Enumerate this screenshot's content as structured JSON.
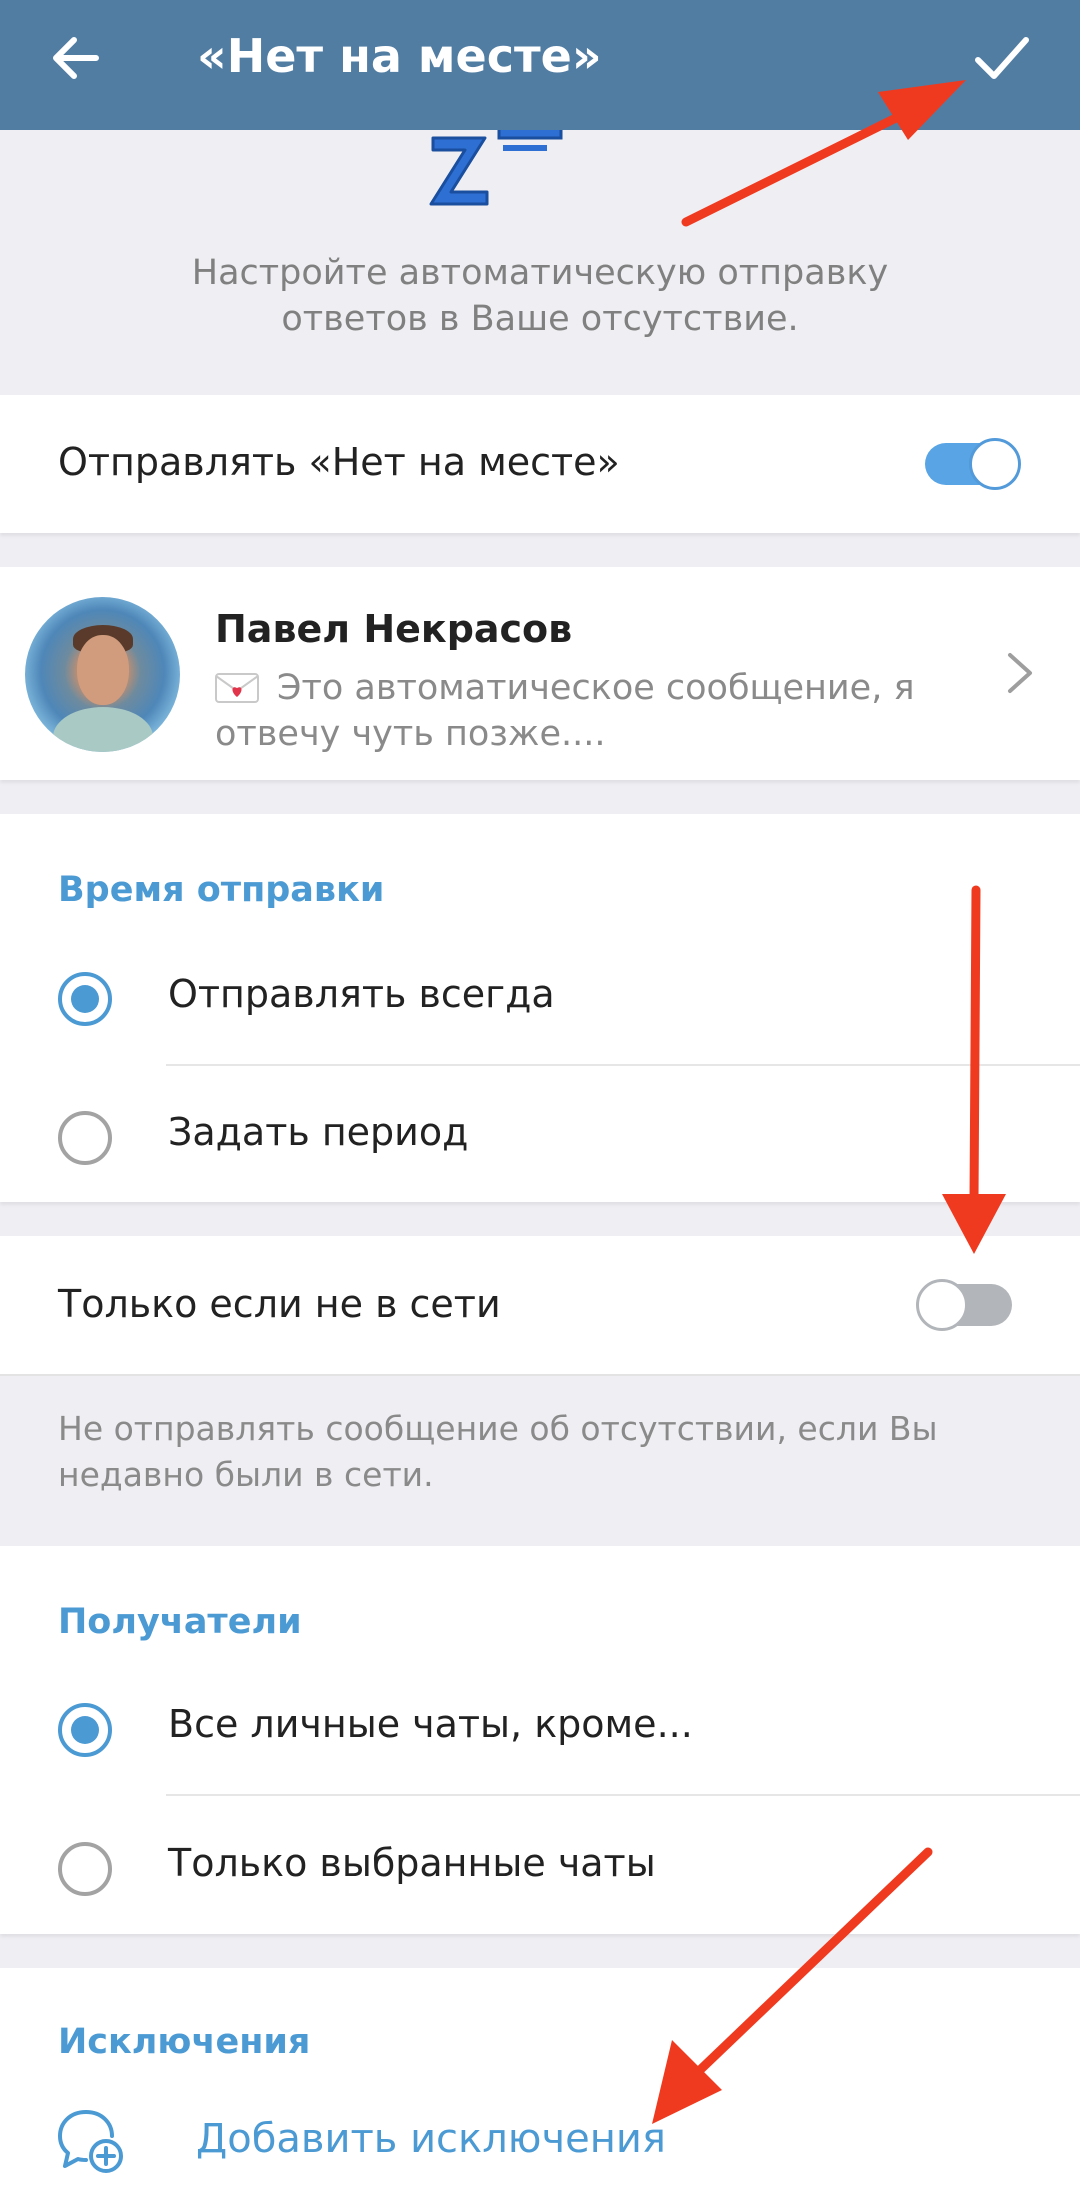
{
  "appbar": {
    "title": "«Нет на месте»"
  },
  "hero": {
    "description": "Настройте автоматическую отправку ответов в Ваше отсутствие."
  },
  "enable": {
    "label": "Отправлять «Нет на месте»",
    "on": true
  },
  "message": {
    "sender": "Павел Некрасов",
    "preview": "Это автоматическое сообщение, я отвечу чуть позже...."
  },
  "schedule": {
    "heading": "Время отправки",
    "options": [
      {
        "label": "Отправлять всегда",
        "selected": true
      },
      {
        "label": "Задать период",
        "selected": false
      }
    ]
  },
  "offline_only": {
    "label": "Только если не в сети",
    "on": false,
    "note": "Не отправлять сообщение об отсутствии, если Вы недавно были в сети."
  },
  "recipients": {
    "heading": "Получатели",
    "options": [
      {
        "label": "Все личные чаты, кроме...",
        "selected": true
      },
      {
        "label": "Только выбранные чаты",
        "selected": false
      }
    ]
  },
  "exceptions": {
    "heading": "Исключения",
    "add_label": "Добавить исключения"
  },
  "colors": {
    "appbar": "#527da3",
    "accent": "#4b9ad4",
    "annotation": "#f03a1f"
  }
}
